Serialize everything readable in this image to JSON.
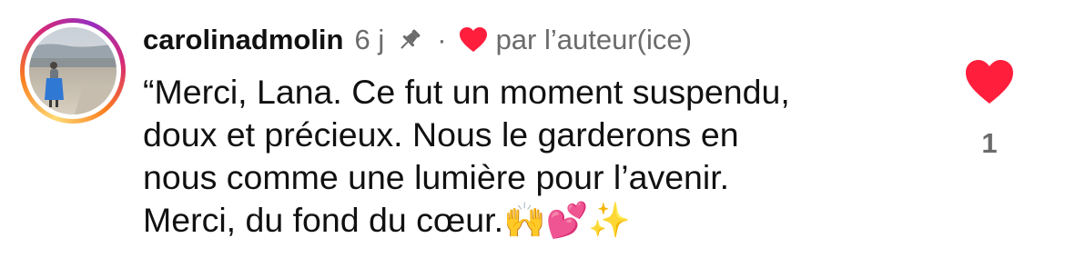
{
  "comment": {
    "username": "carolinadmolin",
    "timestamp": "6 j",
    "separator": "·",
    "author_liked_label": "par l’auteur(ice)",
    "text_lines": [
      "“Merci, Lana. Ce fut un moment suspendu,",
      "doux et précieux. Nous le garderons en",
      "nous comme une lumière pour l’avenir.",
      "Merci, du fond du cœur.🙌💕✨"
    ],
    "like_count": "1"
  },
  "icons": {
    "pin": "pin-icon",
    "author_heart": "heart-icon",
    "like": "heart-icon"
  },
  "colors": {
    "heart": "#ff1e3c",
    "meta_text": "#6b6b6b",
    "text": "#111111"
  }
}
